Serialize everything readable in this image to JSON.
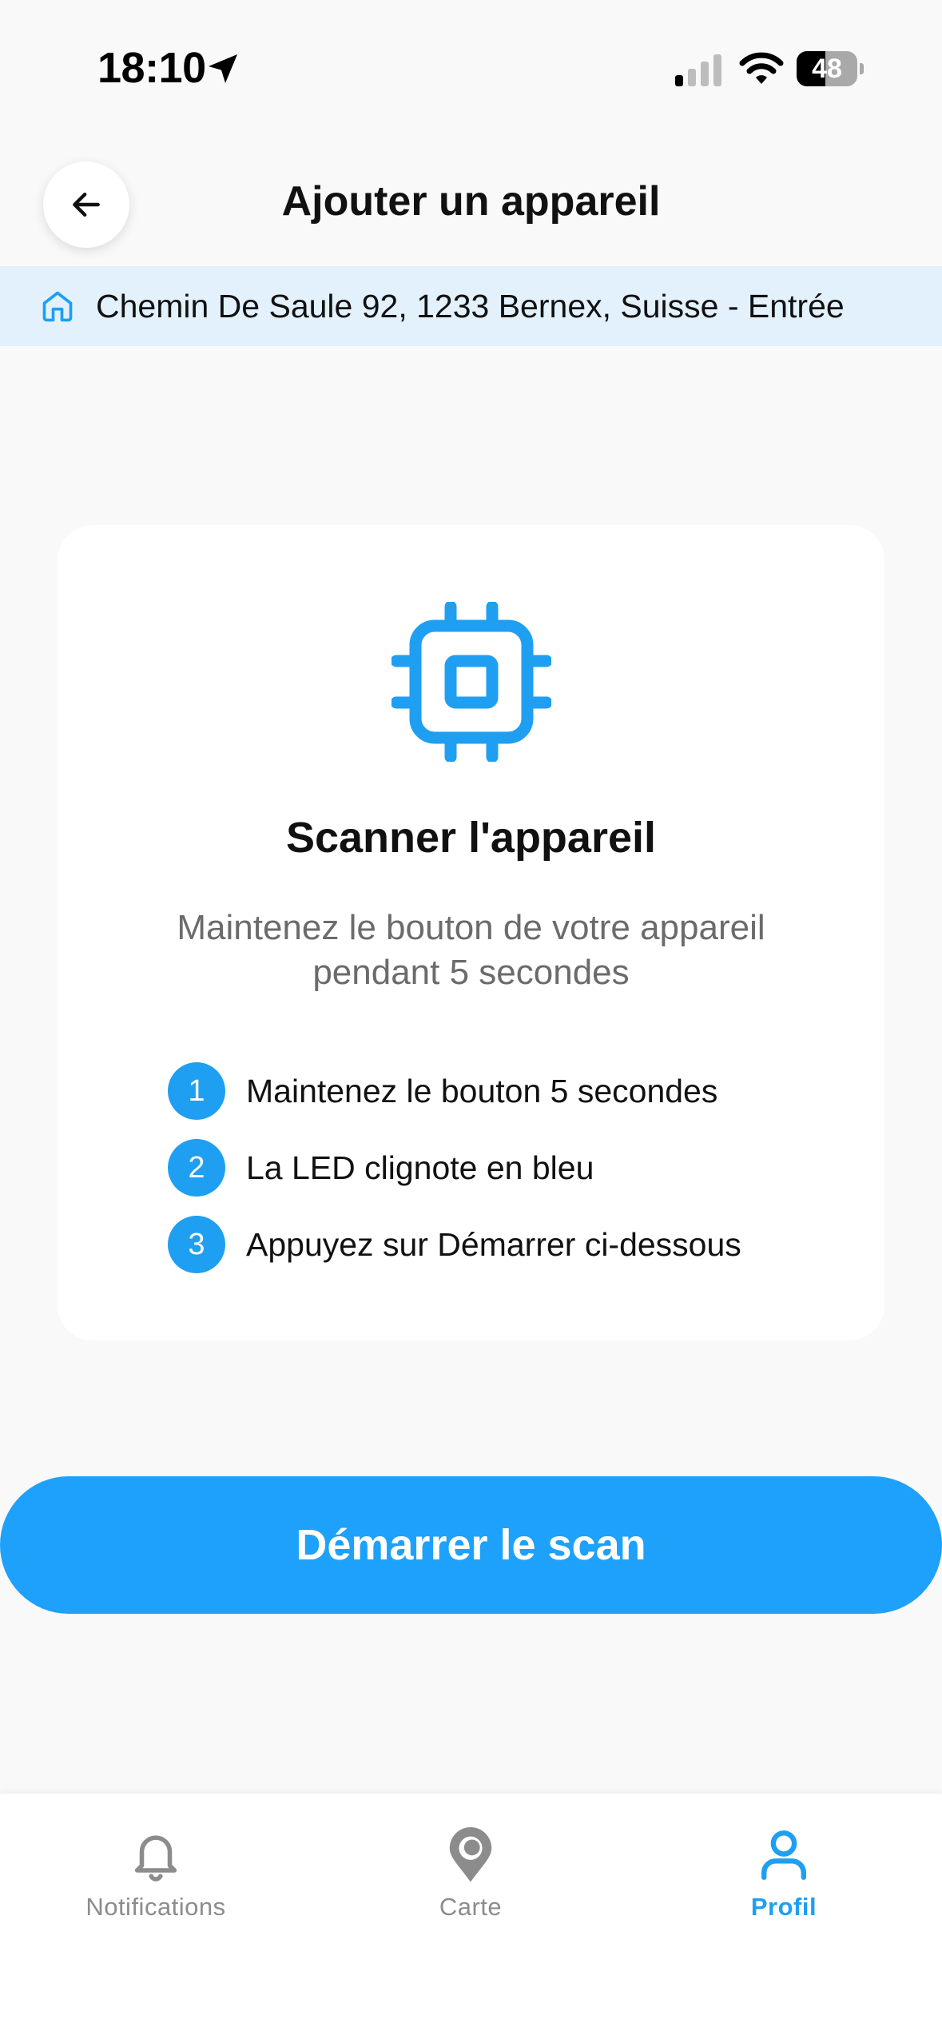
{
  "status_bar": {
    "time": "18:10",
    "battery": "48",
    "battery_level": 0.48,
    "icons": [
      "location-arrow-icon",
      "cellular-signal-icon",
      "wifi-icon",
      "battery-icon"
    ]
  },
  "header": {
    "title": "Ajouter un appareil",
    "back_icon": "arrow-left-icon"
  },
  "address_banner": {
    "icon": "home-icon",
    "text": "Chemin De Saule 92, 1233 Bernex, Suisse - Entrée"
  },
  "scan_card": {
    "icon": "chip-icon",
    "title": "Scanner l'appareil",
    "description": "Maintenez le bouton de votre appareil pendant 5 secondes",
    "steps": [
      {
        "number": "1",
        "text": "Maintenez le bouton 5 secondes"
      },
      {
        "number": "2",
        "text": "La LED clignote en bleu"
      },
      {
        "number": "3",
        "text": "Appuyez sur Démarrer ci-dessous"
      }
    ]
  },
  "primary_button": {
    "label": "Démarrer le scan"
  },
  "tab_bar": {
    "tabs": [
      {
        "label": "Notifications",
        "icon": "bell-icon",
        "active": false
      },
      {
        "label": "Carte",
        "icon": "map-pin-icon",
        "active": false
      },
      {
        "label": "Profil",
        "icon": "user-icon",
        "active": true
      }
    ]
  },
  "colors": {
    "accent": "#1e9ff2",
    "banner_bg": "#e2f1fc",
    "background": "#f9f9f9",
    "inactive": "#8c8c8c"
  }
}
